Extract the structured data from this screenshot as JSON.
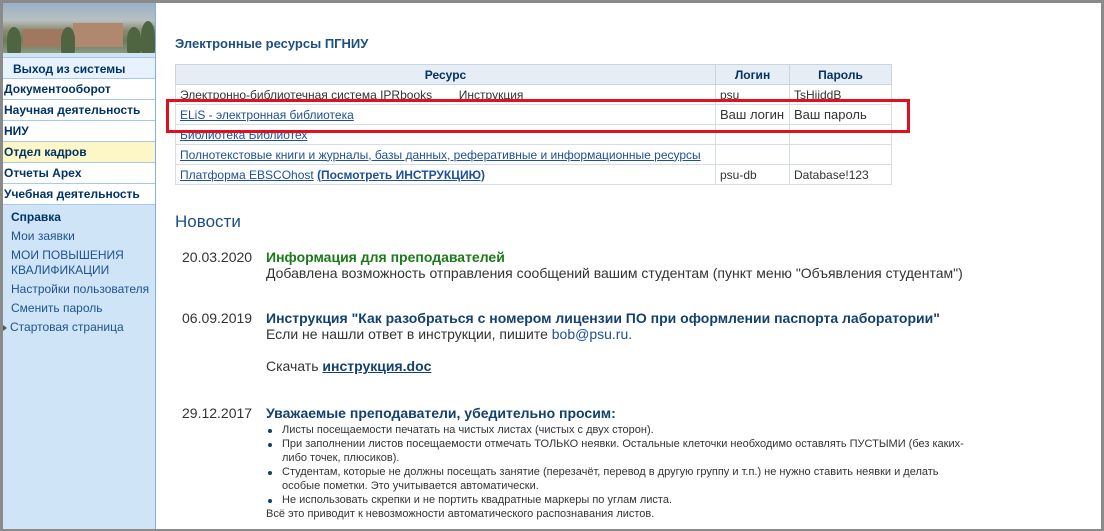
{
  "sidebar": {
    "logout": "Выход из системы",
    "items": [
      {
        "label": "Документооборот"
      },
      {
        "label": "Научная деятельность"
      },
      {
        "label": "НИУ"
      },
      {
        "label": "Отдел кадров"
      },
      {
        "label": "Отчеты Apex"
      },
      {
        "label": "Учебная деятельность"
      }
    ],
    "sub": [
      {
        "label": "Справка"
      },
      {
        "label": "Мои заявки"
      },
      {
        "label": "МОИ ПОВЫШЕНИЯ КВАЛИФИКАЦИИ"
      },
      {
        "label": "Настройки пользователя"
      },
      {
        "label": "Сменить пароль"
      },
      {
        "label": "Стартовая страница"
      }
    ]
  },
  "resources": {
    "title": "Электронные ресурсы ПГНИУ",
    "headers": {
      "resource": "Ресурс",
      "login": "Логин",
      "password": "Пароль"
    },
    "rows": [
      {
        "name": "Электронно-библиотечная система IPRbooks",
        "extra": "Инструкция",
        "login": "psu",
        "password": "TsHiiddB"
      },
      {
        "name": "ELiS - электронная библиотека",
        "login": "Ваш логин",
        "password": "Ваш пароль"
      },
      {
        "name": "Библиотека Библиотех",
        "login": "",
        "password": ""
      },
      {
        "name": "Полнотекстовые книги и журналы, базы данных, реферативные и информационные ресурсы",
        "login": "",
        "password": ""
      },
      {
        "name": "Платформа EBSCOhost",
        "extra": "(Посмотреть ИНСТРУКЦИЮ)",
        "login": "psu-db",
        "password": "Database!123"
      }
    ]
  },
  "news": {
    "title": "Новости",
    "items": [
      {
        "date": "20.03.2020",
        "title": "Информация для преподавателей",
        "text": "Добавлена возможность отправления сообщений вашим студентам (пункт меню \"Объявления студентам\")"
      },
      {
        "date": "06.09.2019",
        "title": "Инструкция \"Как разобраться с номером лицензии ПО при оформлении паспорта лаборатории\"",
        "text": "Если не нашли ответ в инструкции, пишите",
        "email": "bob@psu.ru",
        "download_label": "Скачать",
        "download_link": "инструкция.doc"
      },
      {
        "date": "29.12.2017",
        "title": "Уважаемые преподаватели, убедительно просим:",
        "bullets": [
          "Листы посещаемости печатать на чистых листах (чистых с двух сторон).",
          "При заполнении листов посещаемости отмечать ТОЛЬКО неявки. Остальные клеточки необходимо оставлять ПУСТЫМИ (без каких-либо точек, плюсиков).",
          "Студентам, которые не должны посещать занятие (перезачёт, перевод в другую группу и т.п.) не нужно ставить неявки и делать особые пометки. Это учитывается автоматически.",
          "Не использовать скрепки и не портить квадратные маркеры по углам листа."
        ],
        "footer": "Всё это приводит к невозможности автоматического распознавания листов."
      }
    ]
  },
  "colors": {
    "accent": "#1d4f80",
    "highlight": "#e0111c",
    "sidebar_bg": "#cfe4f7"
  }
}
